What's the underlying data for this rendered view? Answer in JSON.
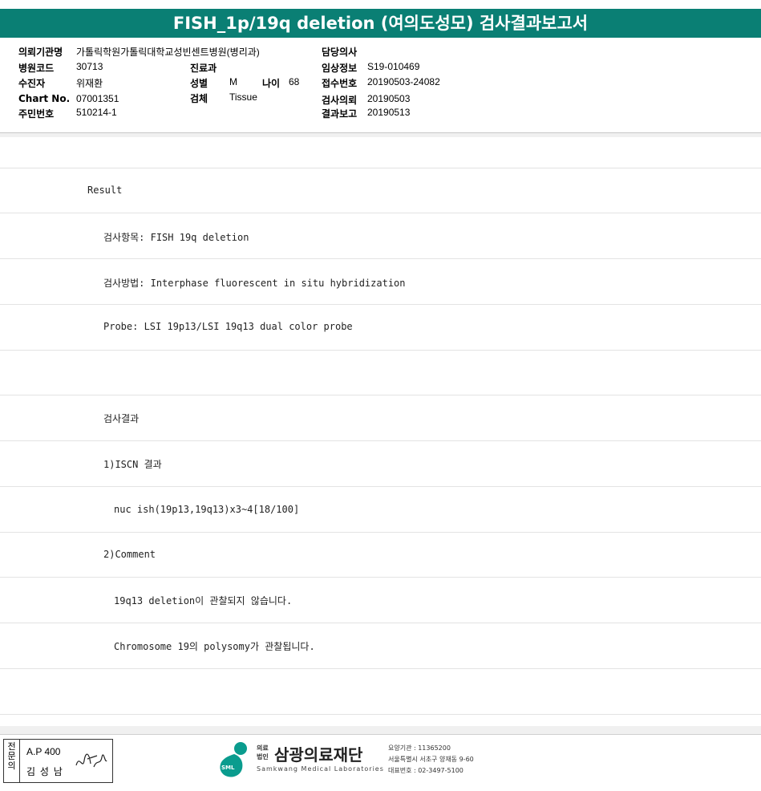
{
  "title": "FISH_1p/19q deletion (여의도성모) 검사결과보고서",
  "header": {
    "institution_label": "의뢰기관명",
    "institution_value": "가톨릭학원가톨릭대학교성빈센트병원(병리과)",
    "hospital_code_label": "병원코드",
    "hospital_code_value": "30713",
    "recipient_label": "수진자",
    "recipient_value": "위재환",
    "chart_label": "Chart No.",
    "chart_value": "07001351",
    "resident_label": "주민번호",
    "resident_value": "510214-1",
    "dept_label": "진료과",
    "dept_value": "",
    "sex_label": "성별",
    "sex_value": "M",
    "age_label": "나이",
    "age_value": "68",
    "specimen_label": "검체",
    "specimen_value": "Tissue",
    "doctor_label": "담당의사",
    "doctor_value": "",
    "clinical_label": "임상정보",
    "clinical_value": "S19-010469",
    "receipt_label": "접수번호",
    "receipt_value": "20190503-24082",
    "request_label": "검사의뢰",
    "request_value": "20190503",
    "report_label": "결과보고",
    "report_value": "20190513"
  },
  "result_lines": [
    "",
    "Result",
    "검사항목: FISH 19q deletion",
    "검사방법: Interphase fluorescent in situ hybridization",
    "Probe: LSI 19p13/LSI 19q13 dual color probe",
    "",
    "검사결과",
    "1)ISCN 결과",
    "nuc ish(19p13,19q13)x3~4[18/100]",
    "2)Comment",
    "19q13 deletion이 관찰되지 않습니다.",
    "Chromosome 19의 polysomy가 관찰됩니다.",
    ""
  ],
  "footer": {
    "stamp_side": "전문의",
    "stamp_code": "A.P 400",
    "stamp_name": "김 성 남",
    "org_prefix_top": "의료",
    "org_prefix_bottom": "법인",
    "org_name": "삼광의료재단",
    "org_name_en": "Samkwang Medical Laboratories",
    "logo_badge": "SML",
    "contact_1": "요양기관 : 11365200",
    "contact_2": "서울특별시 서초구 양재동 9-60",
    "contact_3": "대표번호 : 02-3497-5100"
  },
  "colors": {
    "accent": "#0a7f74"
  }
}
